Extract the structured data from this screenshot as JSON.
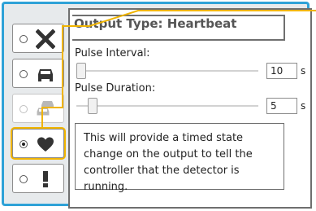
{
  "output": {
    "type_label": "Output Type:",
    "type_value": "Heartbeat"
  },
  "options": [
    {
      "name": "off",
      "icon": "x-icon",
      "state": "normal"
    },
    {
      "name": "vehicle",
      "icon": "car-icon",
      "state": "normal"
    },
    {
      "name": "queue",
      "icon": "multiple-cars-icon",
      "state": "disabled"
    },
    {
      "name": "heartbeat",
      "icon": "heart-icon",
      "state": "selected"
    },
    {
      "name": "alert",
      "icon": "exclamation-icon",
      "state": "normal"
    }
  ],
  "pulse_interval": {
    "label": "Pulse Interval:",
    "value": "10",
    "unit": "s"
  },
  "pulse_duration": {
    "label": "Pulse Duration:",
    "value": "5",
    "unit": "s"
  },
  "description": "This will provide a timed state change on the output to tell the controller that the detector is running.",
  "colors": {
    "frame_border": "#2fa2d7",
    "highlight": "#f0b400",
    "icon": "#333333",
    "icon_disabled": "#b8b8b8"
  }
}
